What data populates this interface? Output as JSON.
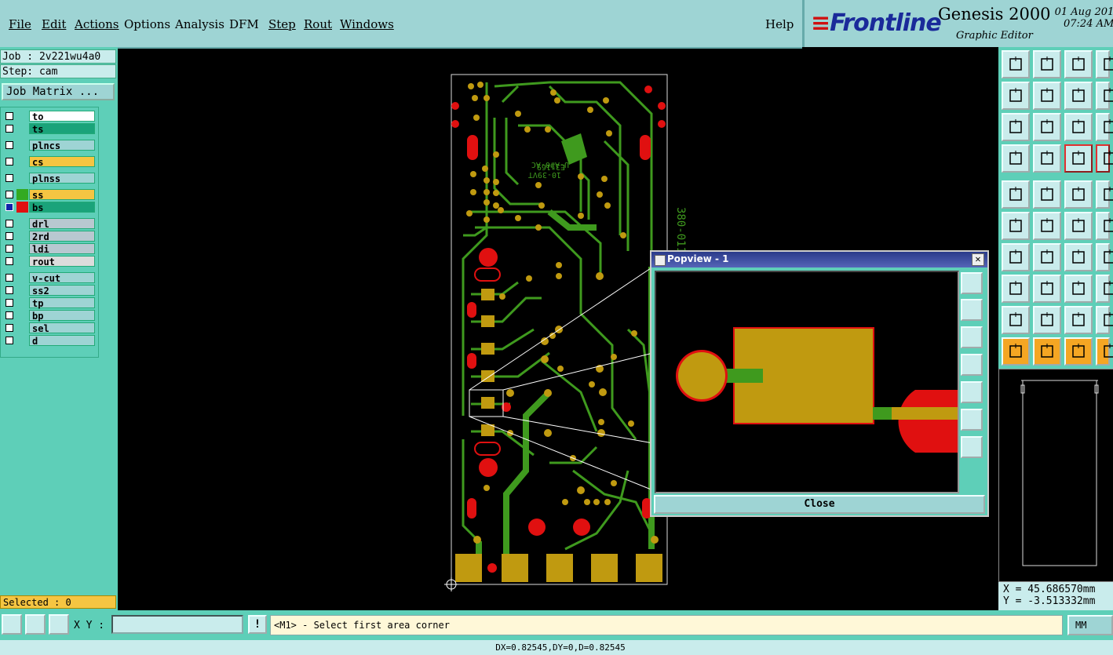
{
  "menu": {
    "items": [
      {
        "label": "File"
      },
      {
        "label": "Edit"
      },
      {
        "label": "Actions"
      },
      {
        "label": "Options"
      },
      {
        "label": "Analysis"
      },
      {
        "label": "DFM"
      },
      {
        "label": "Step"
      },
      {
        "label": "Rout"
      },
      {
        "label": "Windows"
      }
    ],
    "help": "Help"
  },
  "brand": {
    "logo": "Frontline",
    "product": "Genesis 2000",
    "subtitle": "Graphic Editor",
    "date": "01 Aug 201",
    "time": "07:24 AM"
  },
  "job": {
    "job_label": "Job : 2v221wu4a0",
    "step_label": "Step: cam",
    "matrix_button": "Job Matrix ..."
  },
  "layers": [
    {
      "name": "to",
      "color": "#ffffff",
      "checked": false
    },
    {
      "name": "ts",
      "color": "#1aa37a",
      "checked": false
    },
    {
      "name": "plncs",
      "color": "#9ed4d4",
      "checked": false
    },
    {
      "name": "cs",
      "color": "#f5c542",
      "checked": false
    },
    {
      "name": "plnss",
      "color": "#9ed4d4",
      "checked": false
    },
    {
      "name": "ss",
      "color": "#f5c542",
      "checked": false,
      "swatch": "#33aa22"
    },
    {
      "name": "bs",
      "color": "#1aa37a",
      "checked": true,
      "swatch": "#e01010"
    },
    {
      "name": "drl",
      "color": "#b8c8d0",
      "checked": false
    },
    {
      "name": "2rd",
      "color": "#b8c8d0",
      "checked": false
    },
    {
      "name": "ldi",
      "color": "#b8c8d0",
      "checked": false
    },
    {
      "name": "rout",
      "color": "#dcdcdc",
      "checked": false
    },
    {
      "name": "v-cut",
      "color": "#9ed4d4",
      "checked": false
    },
    {
      "name": "ss2",
      "color": "#9ed4d4",
      "checked": false
    },
    {
      "name": "tp",
      "color": "#9ed4d4",
      "checked": false
    },
    {
      "name": "bp",
      "color": "#9ed4d4",
      "checked": false
    },
    {
      "name": "sel",
      "color": "#9ed4d4",
      "checked": false
    },
    {
      "name": "d",
      "color": "#9ed4d4",
      "checked": false
    }
  ],
  "selected_label": "Selected : 0",
  "pcb": {
    "board_text": "380-0114"
  },
  "popview": {
    "title": "Popview - 1",
    "close_label": "Close"
  },
  "toolbar_icons": [
    "zoom-window-icon",
    "zoom-in-icon",
    "home-icon",
    "page-icon",
    "pan-left-icon",
    "pan-right-icon",
    "undo-view-icon",
    "pan-icon",
    "zoom-fit-icon",
    "zoom-center-icon",
    "one-to-one-icon",
    "help-icon",
    "snap-icon",
    "grid-icon",
    "measure-icon",
    "scale-icon",
    "select-icon",
    "draw-line-icon",
    "ruler-icon",
    "pad-icon",
    "network-icon",
    "delete-icon",
    "connect-icon",
    "arc-icon",
    "angle-icon",
    "line-icon",
    "rotate-icon",
    "bracket-icon",
    "highlight-icon",
    "pin-icon",
    "move-icon",
    "question-icon",
    "triangle-icon",
    "triangle-a-icon",
    "triangle-b-icon",
    "triangle-c-icon",
    "pointer-icon",
    "pointer-box-icon",
    "pointer-circle-icon",
    "step-icon"
  ],
  "coords": {
    "x": "X = 45.686570mm",
    "y": "Y = -3.513332mm"
  },
  "bottom": {
    "xy_label": "X Y :",
    "xy_value": "",
    "prompt": "<M1> - Select first area corner",
    "units": "MM"
  },
  "status_line": "DX=0.82545,DY=0,D=0.82545"
}
